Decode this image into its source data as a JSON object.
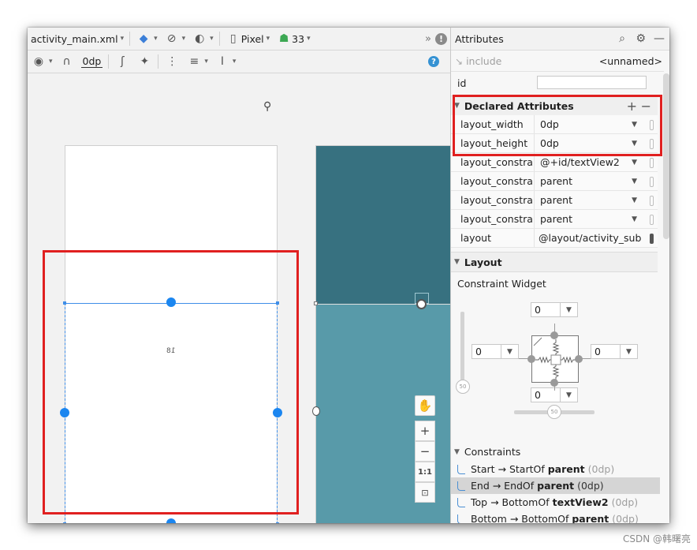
{
  "designer": {
    "file_name": "activity_main.xml",
    "device": "Pixel",
    "api_level": "33",
    "default_margin": "0dp",
    "canvas_label": "18"
  },
  "zoom": {
    "zoom_in": "+",
    "zoom_out": "−",
    "actual_size": "1:1"
  },
  "attributes": {
    "title": "Attributes",
    "include_label": "include",
    "include_value": "<unnamed>",
    "id_label": "id",
    "id_value": "",
    "declared_title": "Declared Attributes",
    "declared": [
      {
        "name": "layout_width",
        "value": "0dp"
      },
      {
        "name": "layout_height",
        "value": "0dp"
      },
      {
        "name": "layout_constrai...",
        "value": "@+id/textView2"
      },
      {
        "name": "layout_constrai...",
        "value": "parent"
      },
      {
        "name": "layout_constrai...",
        "value": "parent"
      },
      {
        "name": "layout_constrai...",
        "value": "parent"
      },
      {
        "name": "layout",
        "value": "@layout/activity_sub"
      }
    ],
    "layout_title": "Layout",
    "constraint_widget_title": "Constraint Widget",
    "margins": {
      "top": "0",
      "left": "0",
      "right": "0",
      "bottom": "0"
    },
    "bias": {
      "vertical": "50",
      "horizontal": "50"
    },
    "constraints_title": "Constraints",
    "constraints": [
      {
        "text": "Start → StartOf",
        "target": "parent",
        "margin": "(0dp)",
        "selected": false
      },
      {
        "text": "End → EndOf",
        "target": "parent",
        "margin": "(0dp)",
        "selected": true
      },
      {
        "text": "Top → BottomOf",
        "target": "textView2",
        "margin": "(0dp)",
        "selected": false
      },
      {
        "text": "Bottom → BottomOf",
        "target": "parent",
        "margin": "(0dp)",
        "selected": false
      }
    ]
  },
  "watermark": "CSDN @韩曙亮",
  "colors": {
    "annotation": "#e02020",
    "blueprint_dark": "#377180",
    "blueprint_light": "#589aa9",
    "selection": "#1b86f0"
  },
  "icons": [
    "layers-icon",
    "orientation-icon",
    "theme-icon",
    "phone-icon",
    "android-icon",
    "more-icon",
    "warning-icon",
    "eye-icon",
    "magnet-icon",
    "clear-constraints-icon",
    "infer-constraints-icon",
    "pack-icon",
    "align-icon",
    "guidelines-icon",
    "help-icon",
    "search-icon",
    "gear-icon",
    "minimize-icon",
    "pin-icon",
    "hand-icon",
    "fit-screen-icon"
  ]
}
